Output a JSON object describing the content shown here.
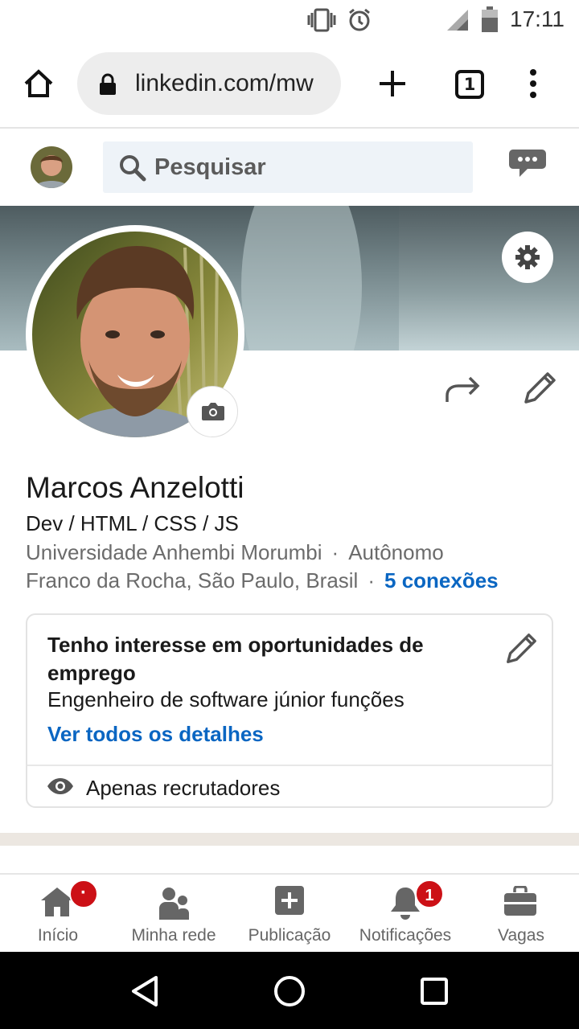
{
  "status_bar": {
    "time": "17:11"
  },
  "browser": {
    "url": "linkedin.com/mw",
    "tab_count": "1"
  },
  "search": {
    "placeholder": "Pesquisar"
  },
  "profile": {
    "name": "Marcos Anzelotti",
    "headline": "Dev / HTML / CSS / JS",
    "education": "Universidade Anhembi Morumbi",
    "company": "Autônomo",
    "location": "Franco da Rocha, São Paulo, Brasil",
    "connections": "5 conexões",
    "separator": "·"
  },
  "open_to_work": {
    "title": "Tenho interesse em oportunidades de emprego",
    "role": "Engenheiro de software júnior funções",
    "details_link": "Ver todos os detalhes",
    "visibility": "Apenas recrutadores"
  },
  "bottom_nav": {
    "items": [
      {
        "label": "Início",
        "icon": "home-icon",
        "badge": ""
      },
      {
        "label": "Minha rede",
        "icon": "network-icon",
        "badge": ""
      },
      {
        "label": "Publicação",
        "icon": "post-icon",
        "badge": ""
      },
      {
        "label": "Notificações",
        "icon": "bell-icon",
        "badge": "1"
      },
      {
        "label": "Vagas",
        "icon": "briefcase-icon",
        "badge": ""
      }
    ],
    "home_badge_dot": "·"
  },
  "colors": {
    "link": "#0a66c2",
    "badge": "#cc1016",
    "search_bg": "#eef3f8"
  }
}
